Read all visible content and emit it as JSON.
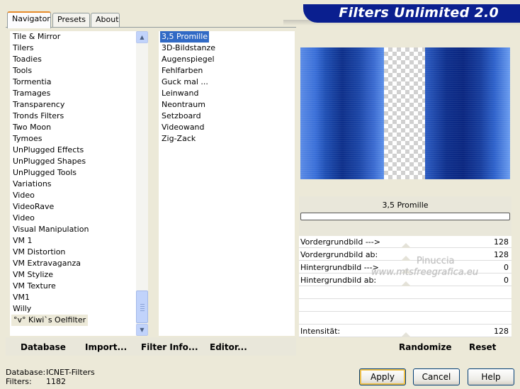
{
  "title": "Filters Unlimited 2.0",
  "tabs": [
    {
      "label": "Navigator",
      "active": true
    },
    {
      "label": "Presets",
      "active": false
    },
    {
      "label": "About",
      "active": false
    }
  ],
  "categories": [
    "Tile & Mirror",
    "Tilers",
    "Toadies",
    "Tools",
    "Tormentia",
    "Tramages",
    "Transparency",
    "Tronds Filters",
    "Two Moon",
    "Tymoes",
    "UnPlugged Effects",
    "UnPlugged Shapes",
    "UnPlugged Tools",
    "Variations",
    "Video",
    "VideoRave",
    "Video",
    "Visual Manipulation",
    "VM 1",
    "VM Distortion",
    "VM Extravaganza",
    "VM Stylize",
    "VM Texture",
    "VM1",
    "Willy",
    "°v° Kiwi`s Oelfilter"
  ],
  "selected_category": "°v° Kiwi`s Oelfilter",
  "filters": [
    "3,5 Promille",
    "3D-Bildstanze",
    "Augenspiegel",
    "Fehlfarben",
    "Guck mal ...",
    "Leinwand",
    "Neontraum",
    "Setzboard",
    "Videowand",
    "Zig-Zack"
  ],
  "selected_filter": "3,5 Promille",
  "scrollbar": {
    "position": 0.92
  },
  "preview": {
    "filter_name": "3,5 Promille",
    "progress": 0
  },
  "parameters": [
    {
      "label": "Vordergrundbild --->",
      "value": "128"
    },
    {
      "label": "Vordergrundbild ab:",
      "value": "128"
    },
    {
      "label": "Hintergrundbild --->",
      "value": "0"
    },
    {
      "label": "Hintergrundbild ab:",
      "value": "0"
    },
    {
      "label": "",
      "value": ""
    },
    {
      "label": "",
      "value": ""
    },
    {
      "label": "",
      "value": ""
    },
    {
      "label": "Intensität:",
      "value": "128"
    }
  ],
  "watermark": {
    "line1": "Pinuccia",
    "line2": "www.mtsfreegrafica.eu"
  },
  "toolbar": {
    "database": "Database",
    "import": "Import...",
    "filter_info": "Filter Info...",
    "editor": "Editor...",
    "randomize": "Randomize",
    "reset": "Reset"
  },
  "status": {
    "database_label": "Database:",
    "database_value": "ICNET-Filters",
    "filters_label": "Filters:",
    "filters_value": "1182"
  },
  "buttons": {
    "apply": "Apply",
    "cancel": "Cancel",
    "help": "Help"
  },
  "colors": {
    "accent": "#316ac5",
    "banner": "#0a1f8f"
  }
}
